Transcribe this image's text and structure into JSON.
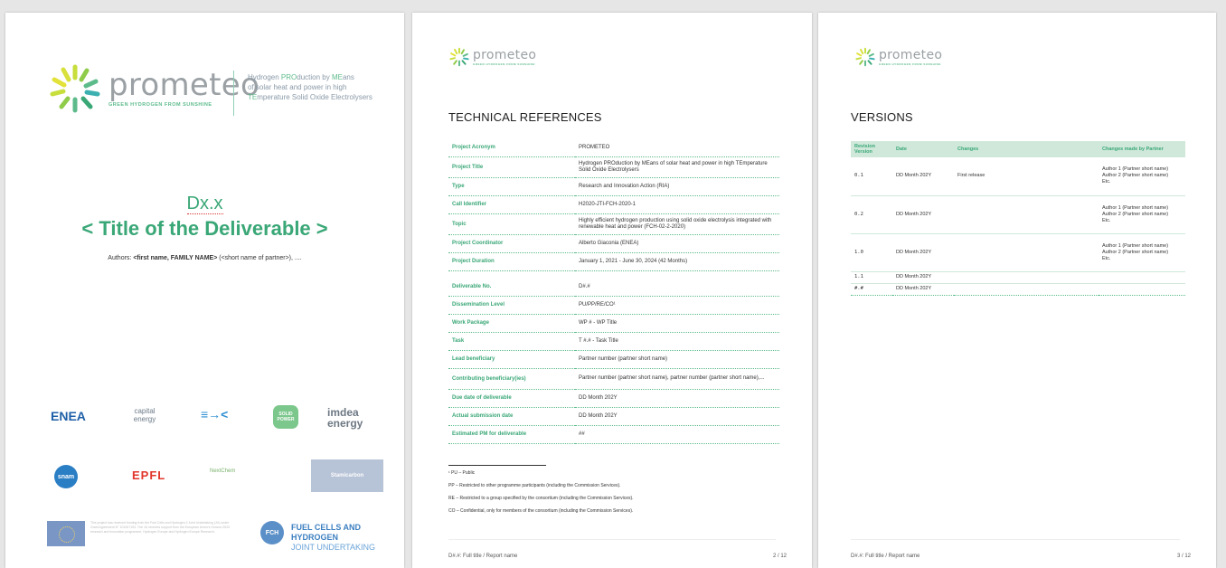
{
  "cover": {
    "brand": "prometeo",
    "tagline": "GREEN HYDROGEN FROM SUNSHINE",
    "project_line1a": "Hydrogen ",
    "project_line1b": "PRO",
    "project_line1c": "duction by ",
    "project_line1d": "ME",
    "project_line1e": "ans",
    "project_line2": "of solar heat and power in high",
    "project_line3a": "TE",
    "project_line3b": "mperature Solid Oxide Electrolysers",
    "deliverable_id": "Dx.x",
    "deliverable_title": "< Title of the Deliverable >",
    "authors_prefix": "Authors: ",
    "authors_name": "<first name, FAMILY NAME>",
    "authors_suffix": " (<short name of partner>), ....",
    "partners": [
      "ENEA",
      "capital energy",
      "≡→<",
      "SOLID POWER",
      "imdea energy",
      "snam",
      "EPFL",
      "NextChem",
      "Stamicarbon"
    ],
    "funding_text": "This project has received funding from the Fuel Cells and Hydrogen 2 Joint Undertaking (JU) under Grant Agreement N° 101007194. The JU receives support from the European Union's Horizon 2020 research and innovation programme, Hydrogen Europe and Hydrogen Europe Research.",
    "fch_badge": "FCH",
    "fch_title": "FUEL CELLS AND HYDROGEN",
    "fch_sub": "JOINT UNDERTAKING"
  },
  "tech": {
    "brand": "prometeo",
    "tagline": "GREEN HYDROGEN FROM SUNSHINE",
    "title": "TECHNICAL REFERENCES",
    "rows": [
      {
        "label": "Project Acronym",
        "value": "PROMETEO"
      },
      {
        "label": "Project Title",
        "value": "Hydrogen PROduction by MEans of solar heat and power in high TEmperature Solid Oxide Electrolysers"
      },
      {
        "label": "Type",
        "value": "Research and Innovation Action (RIA)"
      },
      {
        "label": "Call Identifier",
        "value": "H2020-JTI-FCH-2020-1"
      },
      {
        "label": "Topic",
        "value": "Highly efficient hydrogen production using solid oxide electrolysis integrated with renewable heat and power (FCH-02-2-2020)"
      },
      {
        "label": "Project Coordinator",
        "value": "Alberto Giaconia (ENEA)"
      },
      {
        "label": "Project Duration",
        "value": "January 1, 2021 - June 30, 2024 (42 Months)"
      },
      {
        "label": "Deliverable No.",
        "value": "D#.#"
      },
      {
        "label": "Dissemination Level",
        "value": "PU/PP/RE/CO¹"
      },
      {
        "label": "Work Package",
        "value": "WP # - WP Title"
      },
      {
        "label": "Task",
        "value": "T #.# - Task Title"
      },
      {
        "label": "Lead beneficiary",
        "value": "Partner number (partner short name)"
      },
      {
        "label": "Contributing beneficiary(ies)",
        "value": "Partner number (partner short name), partner number (partner short name),..."
      },
      {
        "label": "Due date of deliverable",
        "value": "DD Month 202Y"
      },
      {
        "label": "Actual submission date",
        "value": "DD Month 202Y"
      },
      {
        "label": "Estimated PM for deliverable",
        "value": "##"
      }
    ],
    "footnotes": [
      "¹ PU – Public",
      "PP – Restricted to other programme participants (including the Commission Services).",
      "RE – Restricted to a group specified by the consortium (including the Commission Services).",
      "CO – Confidential, only for members of the consortium (including the Commission Services)."
    ],
    "footer_left": "D#.#: Full title / Report name",
    "footer_right": "2 / 12"
  },
  "versions": {
    "brand": "prometeo",
    "tagline": "GREEN HYDROGEN FROM SUNSHINE",
    "title": "VERSIONS",
    "headers": [
      "Revision Version",
      "Date",
      "Changes",
      "Changes made by Partner"
    ],
    "rows": [
      {
        "version": "0.1",
        "date": "DD Month 202Y",
        "changes": "First release",
        "partner": "Author 1 (Partner short name)\nAuthor 2 (Partner short name)\nEtc."
      },
      {
        "version": "0.2",
        "date": "DD Month 202Y",
        "changes": "",
        "partner": "Author 1 (Partner short name)\nAuthor 2 (Partner short name)\nEtc."
      },
      {
        "version": "1.0",
        "date": "DD Month 202Y",
        "changes": "",
        "partner": "Author 1 (Partner short name)\nAuthor 2 (Partner short name)\nEtc."
      },
      {
        "version": "1.1",
        "date": "DD Month 202Y",
        "changes": "",
        "partner": ""
      },
      {
        "version": "#.#",
        "date": "DD Month 202Y",
        "changes": "",
        "partner": ""
      }
    ],
    "footer_left": "D#.#: Full title / Report name",
    "footer_right": "3 / 12"
  },
  "colors": {
    "accent": "#3aa777",
    "light_green": "#cfe8da",
    "logo_grey": "#9aa0a4"
  }
}
